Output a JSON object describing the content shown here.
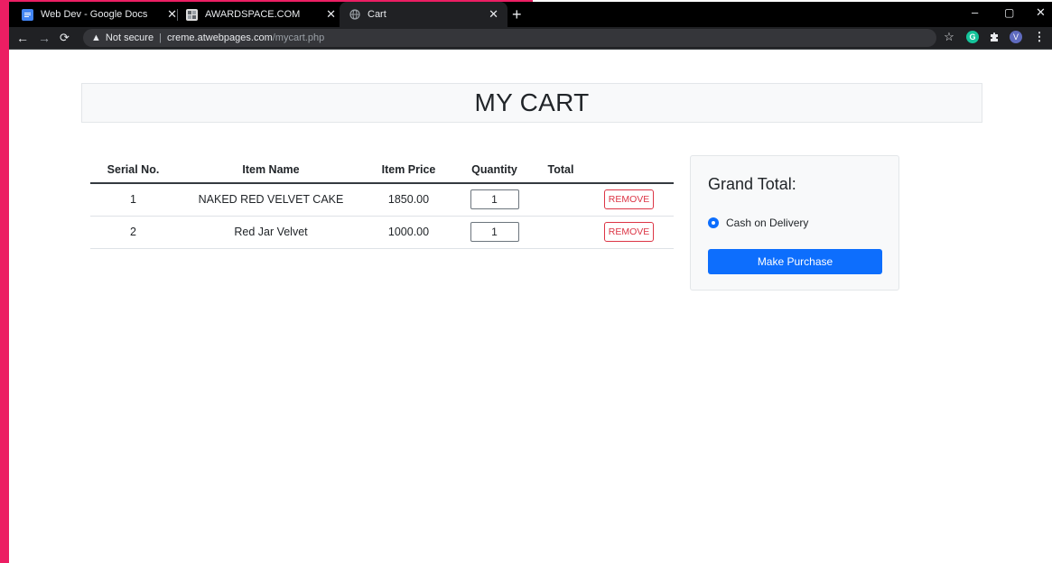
{
  "browser": {
    "tabs": [
      {
        "title": "Web Dev - Google Docs",
        "favicon": "docs-icon",
        "favicon_color": "#4285f4"
      },
      {
        "title": "AWARDSPACE.COM",
        "favicon": "awardspace-icon",
        "favicon_color": "#ffffff"
      },
      {
        "title": "Cart",
        "favicon": "globe-icon",
        "active": true
      }
    ],
    "tab_close_glyph": "✕",
    "new_tab_glyph": "+",
    "window_controls": {
      "minimize": "–",
      "maximize": "▢",
      "close": "✕"
    },
    "address": {
      "security_label": "Not secure",
      "domain": "creme.atwebpages.com",
      "path": "/mycart.php"
    },
    "profile_initial": "V"
  },
  "page": {
    "title": "MY CART",
    "table": {
      "headers": [
        "Serial No.",
        "Item Name",
        "Item Price",
        "Quantity",
        "Total",
        ""
      ],
      "rows": [
        {
          "serial": "1",
          "name": "NAKED RED VELVET CAKE",
          "price": "1850.00",
          "quantity": "1",
          "total": ""
        },
        {
          "serial": "2",
          "name": "Red Jar Velvet",
          "price": "1000.00",
          "quantity": "1",
          "total": ""
        }
      ],
      "remove_label": "REMOVE"
    },
    "summary": {
      "heading": "Grand Total:",
      "payment_option": "Cash on Delivery",
      "purchase_label": "Make Purchase"
    }
  },
  "colors": {
    "accent": "#0d6efd",
    "danger": "#dc3545",
    "side_strip": "#ec1e63"
  }
}
